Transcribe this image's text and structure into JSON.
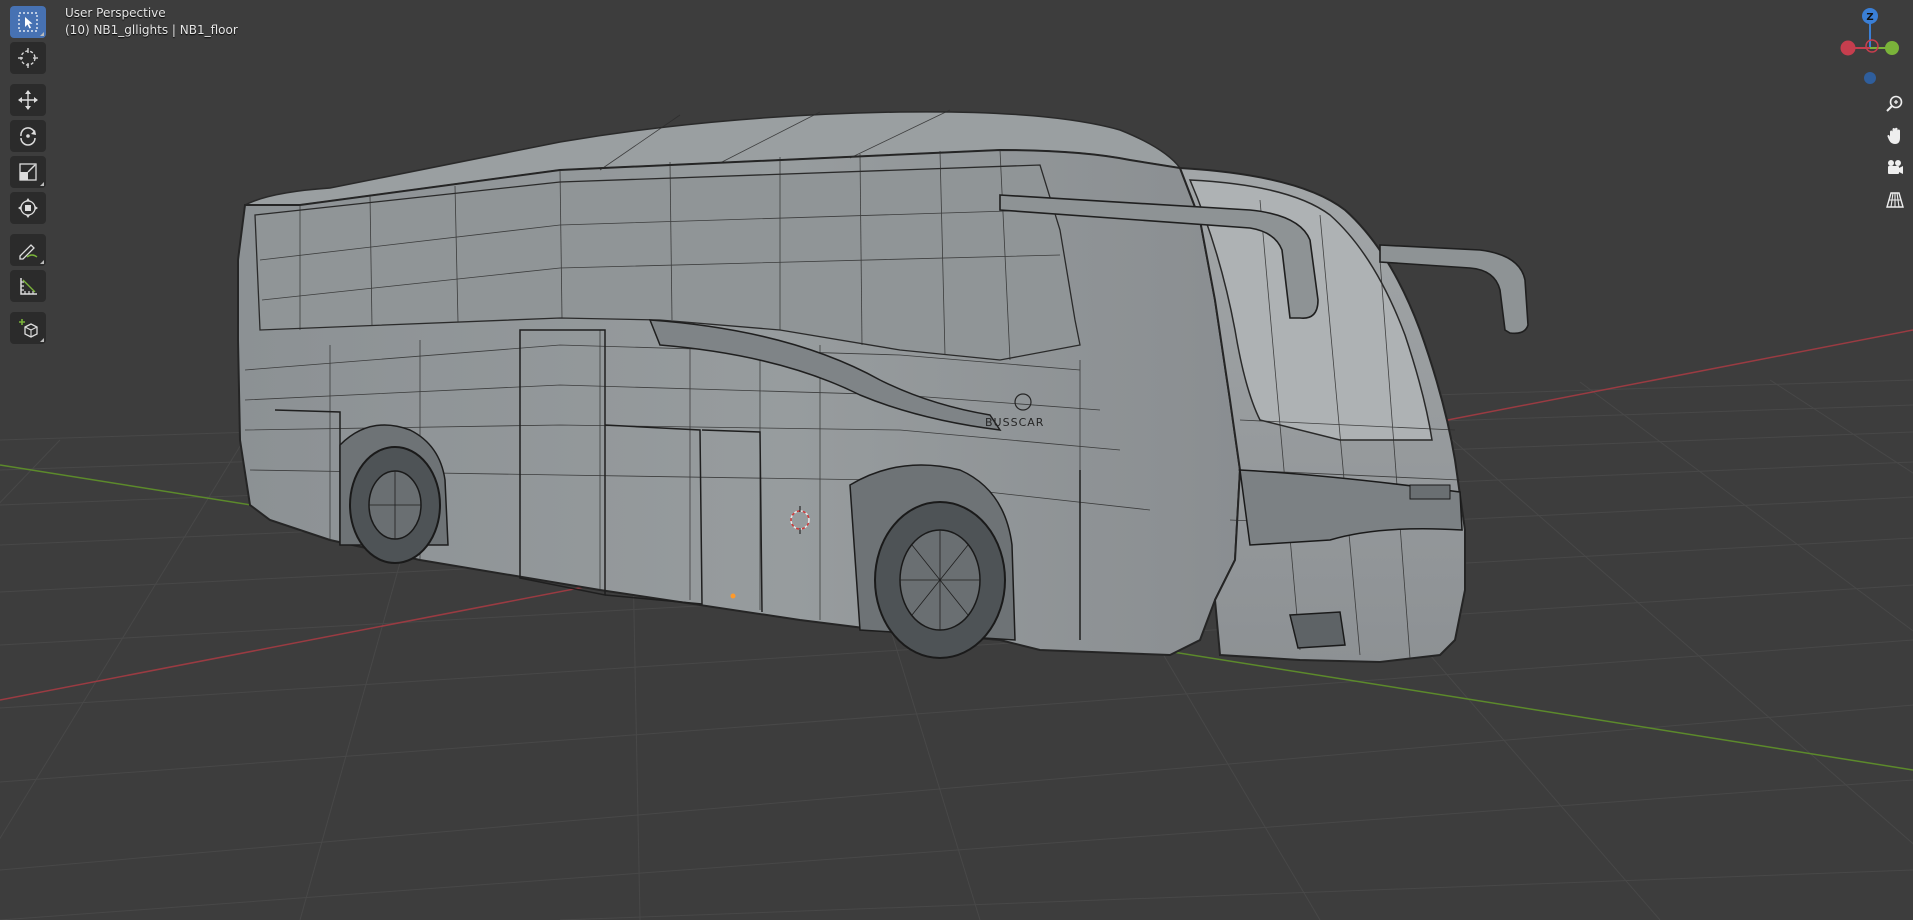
{
  "viewport": {
    "view_name": "User Perspective",
    "object_info": "(10) NB1_gllights | NB1_floor"
  },
  "toolbar": {
    "tools": [
      {
        "name": "select-box",
        "icon": "select-box-icon",
        "active": true
      },
      {
        "name": "cursor",
        "icon": "cursor-icon"
      },
      {
        "name": "move",
        "icon": "move-icon"
      },
      {
        "name": "rotate",
        "icon": "rotate-icon"
      },
      {
        "name": "scale",
        "icon": "scale-icon"
      },
      {
        "name": "transform",
        "icon": "transform-icon"
      },
      {
        "name": "annotate",
        "icon": "annotate-icon"
      },
      {
        "name": "measure",
        "icon": "measure-icon"
      },
      {
        "name": "add-cube",
        "icon": "add-cube-icon"
      }
    ]
  },
  "gizmo": {
    "z_label": "Z",
    "x_color": "#c63e4e",
    "y_color": "#7ab33a",
    "z_color": "#3a7fd6"
  },
  "nav": [
    "zoom-icon",
    "pan-hand-icon",
    "camera-icon",
    "grid-perspective-icon"
  ],
  "colors": {
    "background": "#3d3d3d",
    "active_tool": "#4772b3",
    "x_axis": "#9a3b42",
    "y_axis": "#5c8a2b",
    "wire": "#262626",
    "model_body": "#8f9496"
  }
}
